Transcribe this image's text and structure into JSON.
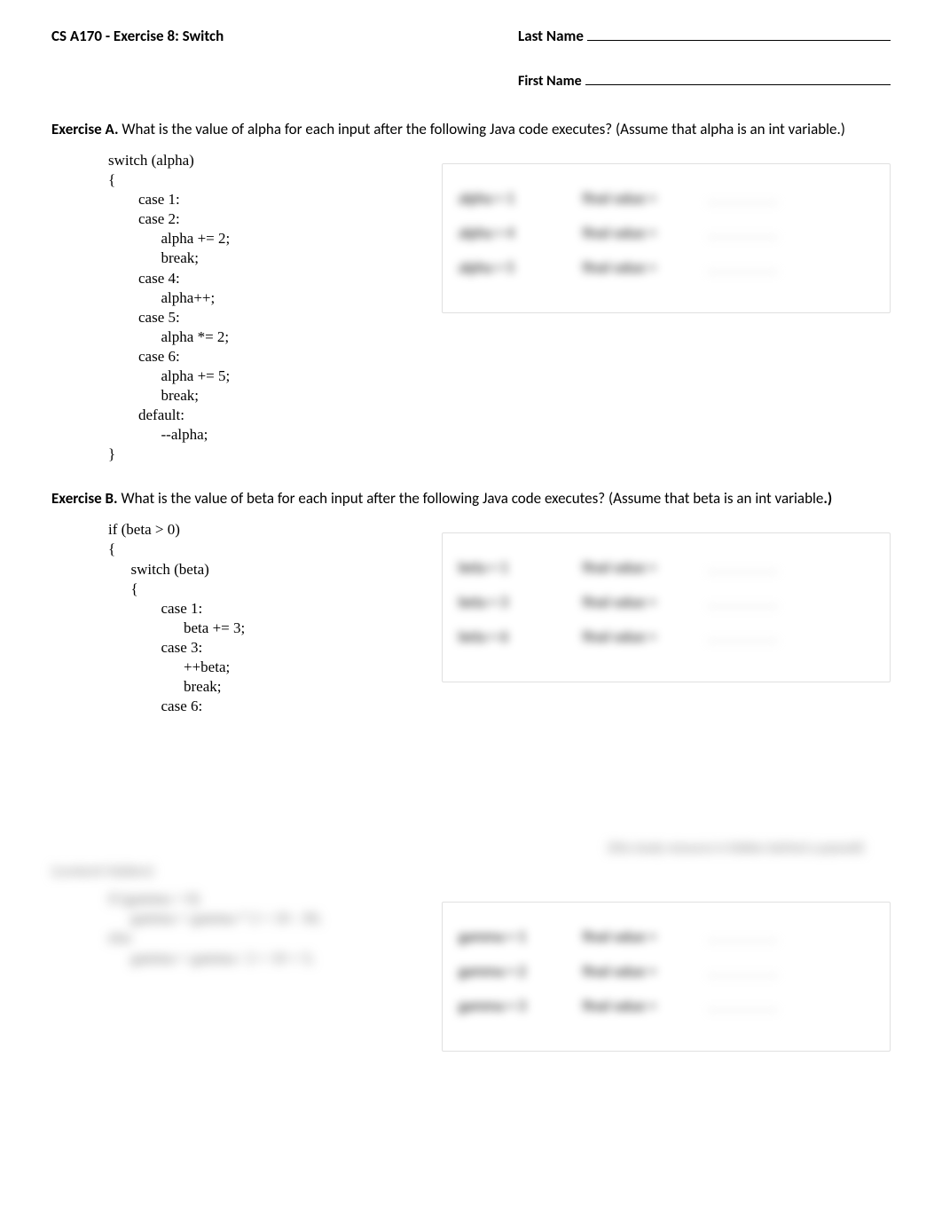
{
  "header": {
    "title": "CS A170 - Exercise 8: Switch",
    "last_name_label": "Last Name",
    "first_name_label": "First Name"
  },
  "exerciseA": {
    "label": "Exercise A.",
    "text": " What is the value of alpha for each input after the following Java code executes? (Assume that alpha is an int variable.)",
    "code": "switch (alpha)\n{\n        case 1:\n        case 2:\n              alpha += 2;\n              break;\n        case 4:\n              alpha++;\n        case 5:\n              alpha *= 2;\n        case 6:\n              alpha += 5;\n              break;\n        default:\n              --alpha;\n}",
    "rows": [
      {
        "input": "alpha = 1",
        "output": "final value ="
      },
      {
        "input": "alpha = 4",
        "output": "final value ="
      },
      {
        "input": "alpha = 5",
        "output": "final value ="
      }
    ]
  },
  "exerciseB": {
    "label": "Exercise B.",
    "text": " What is the value of beta for each input after the following Java code executes? (Assume that beta is an int variable",
    "text_suffix": ".)",
    "code": "if (beta > 0)\n{\n      switch (beta)\n      {\n              case 1:\n                    beta += 3;\n              case 3:\n                    ++beta;\n                    break;\n              case 6:",
    "rows": [
      {
        "input": "beta = 1",
        "output": "final value ="
      },
      {
        "input": "beta = 3",
        "output": "final value ="
      },
      {
        "input": "beta = 6",
        "output": "final value ="
      }
    ]
  },
  "exerciseC": {
    "blurred_prompt": "(content hidden)",
    "blurred_hint": "(this study resource is hidden behind a paywall)",
    "code": "if (gamma > 0)\n      gamma = gamma * 2 + 10 - 30;\nelse\n      gamma = gamma / 2 + 10 + 5;",
    "rows": [
      {
        "input": "gamma = 1",
        "output": "final value ="
      },
      {
        "input": "gamma = 2",
        "output": "final value ="
      },
      {
        "input": "gamma = 3",
        "output": "final value ="
      }
    ]
  }
}
